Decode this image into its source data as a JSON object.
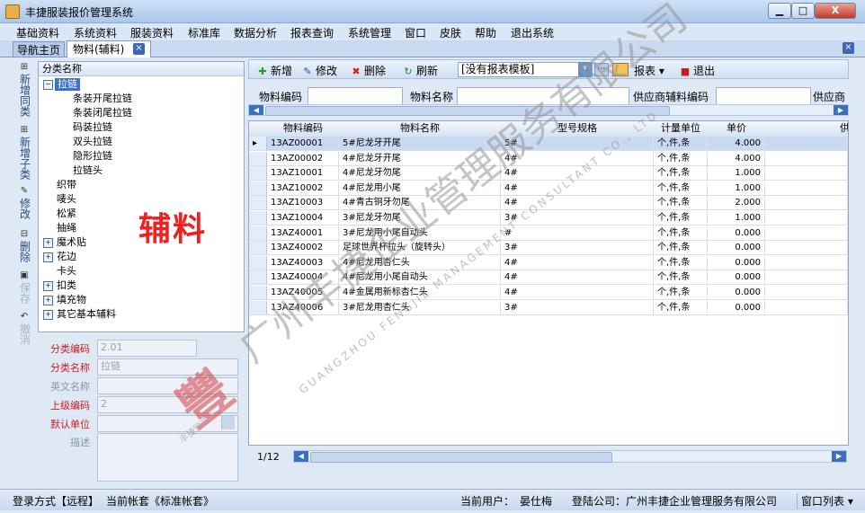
{
  "window": {
    "title": "丰捷服装报价管理系统",
    "min": "▁",
    "max": "□",
    "close": "X"
  },
  "menu": [
    "基础资料",
    "系统资料",
    "服装资料",
    "标准库",
    "数据分析",
    "报表查询",
    "系统管理",
    "窗口",
    "皮肤",
    "帮助",
    "退出系统"
  ],
  "tabs": {
    "home": "导航主页",
    "material": "物料(辅料)",
    "close": "×"
  },
  "left_tools": [
    {
      "icon": "tree-icon",
      "glyph": "⊞",
      "label": "新增同类"
    },
    {
      "icon": "tree-icon",
      "glyph": "⊞",
      "label": "新增子类"
    },
    {
      "icon": "edit-icon",
      "glyph": "✎",
      "label": "修改"
    },
    {
      "icon": "delete-icon",
      "glyph": "⊟",
      "label": "删除"
    },
    {
      "icon": "save-icon",
      "glyph": "▣",
      "label": "保存"
    },
    {
      "icon": "cancel-icon",
      "glyph": "↶",
      "label": "撤消"
    }
  ],
  "tree": {
    "header": "分类名称",
    "nodes": [
      {
        "label": "拉链",
        "expander": "−",
        "selected": true
      },
      {
        "label": "条装开尾拉链"
      },
      {
        "label": "条装闭尾拉链"
      },
      {
        "label": "码装拉链"
      },
      {
        "label": "双头拉链"
      },
      {
        "label": "隐形拉链"
      },
      {
        "label": "拉链头"
      },
      {
        "label": "织带"
      },
      {
        "label": "唛头"
      },
      {
        "label": "松紧"
      },
      {
        "label": "抽绳"
      },
      {
        "label": "魔术贴",
        "expander": "+"
      },
      {
        "label": "花边",
        "expander": "+"
      },
      {
        "label": "卡头"
      },
      {
        "label": "扣类",
        "expander": "+"
      },
      {
        "label": "填充物",
        "expander": "+"
      },
      {
        "label": "其它基本辅料",
        "expander": "+"
      }
    ],
    "big_label": "辅料"
  },
  "form": {
    "code_label": "分类编码",
    "code_value": "2.01",
    "name_label": "分类名称",
    "name_value": "拉链",
    "en_label": "英文名称",
    "en_value": "",
    "parent_label": "上级编码",
    "parent_value": "2",
    "unit_label": "默认单位",
    "unit_value": "",
    "desc_label": "描述",
    "desc_value": ""
  },
  "toolbar": {
    "add": "新增",
    "edit": "修改",
    "delete": "删除",
    "refresh": "刷新",
    "template": "[没有报表模板]",
    "report": "报表",
    "exit": "退出",
    "more": "···",
    "dropdown": "▾"
  },
  "search": {
    "code_label": "物料编码",
    "name_label": "物料名称",
    "supplier_code_label": "供应商辅料编码",
    "supplier_label": "供应商"
  },
  "grid": {
    "columns": [
      "物料编码",
      "物料名称",
      "型号规格",
      "计量单位",
      "单价",
      "供"
    ],
    "rows": [
      [
        "13AZ00001",
        "5#尼龙牙开尾",
        "5#",
        "个,件,条",
        "4.000"
      ],
      [
        "13AZ00002",
        "4#尼龙牙开尾",
        "4#",
        "个,件,条",
        "4.000"
      ],
      [
        "13AZ10001",
        "4#尼龙牙勿尾",
        "4#",
        "个,件,条",
        "1.000"
      ],
      [
        "13AZ10002",
        "4#尼龙用小尾",
        "4#",
        "个,件,条",
        "1.000"
      ],
      [
        "13AZ10003",
        "4#青古铜牙勿尾",
        "4#",
        "个,件,条",
        "2.000"
      ],
      [
        "13AZ10004",
        "3#尼龙牙勿尾",
        "3#",
        "个,件,条",
        "1.000"
      ],
      [
        "13AZ40001",
        "3#尼龙用小尾自动头",
        "#",
        "个,件,条",
        "0.000"
      ],
      [
        "13AZ40002",
        "足球世界杯拉头（旋转头）",
        "3#",
        "个,件,条",
        "0.000"
      ],
      [
        "13AZ40003",
        "4#尼龙用杏仁头",
        "4#",
        "个,件,条",
        "0.000"
      ],
      [
        "13AZ40004",
        "4#尼龙用小尾自动头",
        "4#",
        "个,件,条",
        "0.000"
      ],
      [
        "13AZ40005",
        "4#金属用新标杏仁头",
        "4#",
        "个,件,条",
        "0.000"
      ],
      [
        "13AZ40006",
        "3#尼龙用杏仁头",
        "3#",
        "个,件,条",
        "0.000"
      ]
    ],
    "selected_indicator": "▸"
  },
  "pager": {
    "page": "1/12"
  },
  "watermark": {
    "cn": "广州丰捷企业管理服务有限公司",
    "en": "GUANGZHOU FENGJIE MANAGEMENT CONSULTANT CO., LTD",
    "logo": "豐",
    "sign": "丰捷管理"
  },
  "status": {
    "login_mode": "登录方式【远程】",
    "account": "当前帐套《标准帐套》",
    "user_label": "当前用户：",
    "user": "晏仕梅",
    "company_label": "登陆公司：",
    "company": "广州丰捷企业管理服务有限公司",
    "window_list": "窗口列表 ▾"
  }
}
